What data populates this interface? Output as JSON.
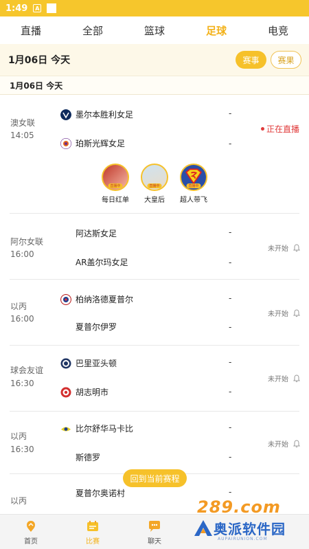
{
  "status_bar": {
    "time": "1:49",
    "icon_a": "A"
  },
  "tabs": [
    {
      "label": "直播"
    },
    {
      "label": "全部"
    },
    {
      "label": "篮球"
    },
    {
      "label": "足球"
    },
    {
      "label": "电竞"
    }
  ],
  "active_tab": "足球",
  "date_header": {
    "text": "1月06日  今天",
    "btn_schedule": "赛事",
    "btn_results": "赛果"
  },
  "date_sub": "1月06日  今天",
  "matches": [
    {
      "league": "澳女联",
      "time": "14:05",
      "home": "墨尔本胜利女足",
      "away": "珀斯光辉女足",
      "home_score": "-",
      "away_score": "-",
      "status": "正在直播",
      "streamers": [
        {
          "name": "每日红单",
          "tag": "直播中"
        },
        {
          "name": "大皇后",
          "tag": "直播中"
        },
        {
          "name": "超人带飞",
          "tag": "直播中"
        }
      ]
    },
    {
      "league": "阿尔女联",
      "time": "16:00",
      "home": "阿达斯女足",
      "away": "AR盖尔玛女足",
      "home_score": "-",
      "away_score": "-",
      "status": "未开始"
    },
    {
      "league": "以丙",
      "time": "16:00",
      "home": "柏纳洛德夏普尔",
      "away": "夏普尔伊罗",
      "home_score": "-",
      "away_score": "-",
      "status": "未开始"
    },
    {
      "league": "球会友谊",
      "time": "16:30",
      "home": "巴里亚头顿",
      "away": "胡志明市",
      "home_score": "-",
      "away_score": "-",
      "status": "未开始"
    },
    {
      "league": "以丙",
      "time": "16:30",
      "home": "比尔舒华马卡比",
      "away": "斯德罗",
      "home_score": "-",
      "away_score": "-",
      "status": "未开始"
    },
    {
      "league": "以丙",
      "time": "",
      "home": "夏普尔奥诺村",
      "away": "",
      "home_score": "-",
      "away_score": "",
      "status": ""
    }
  ],
  "return_button": "回到当前赛程",
  "bottom_nav": [
    {
      "label": "首页"
    },
    {
      "label": "比赛"
    },
    {
      "label": "聊天"
    }
  ],
  "active_nav": "比赛",
  "watermark": {
    "top": "289.com",
    "name": "奥派软件园",
    "url": "AUPAIRUNION.COM"
  },
  "colors": {
    "accent": "#f6c12a",
    "live": "#e03a3a",
    "header_bg": "#fdf8e8"
  }
}
